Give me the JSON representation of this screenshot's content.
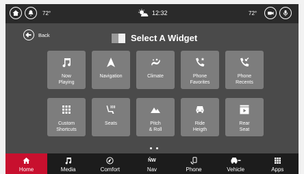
{
  "status": {
    "temp_left": "72°",
    "temp_right": "72°",
    "time": "12:32"
  },
  "header": {
    "back_label": "Back",
    "title": "Select A Widget",
    "accent_color": "#c8102e"
  },
  "widgets": [
    {
      "label": "Now\nPlaying",
      "icon": "music-note-icon"
    },
    {
      "label": "Navigation",
      "icon": "navigation-arrow-icon"
    },
    {
      "label": "Climate",
      "icon": "climate-fan-icon"
    },
    {
      "label": "Phone\nFavorites",
      "icon": "phone-star-icon"
    },
    {
      "label": "Phone\nRecents",
      "icon": "phone-recent-icon"
    },
    {
      "label": "Custom\nShortcuts",
      "icon": "grid-icon"
    },
    {
      "label": "Seats",
      "icon": "seat-heat-icon"
    },
    {
      "label": "Pitch\n& Roll",
      "icon": "mountain-icon"
    },
    {
      "label": "Ride\nHeigth",
      "icon": "vehicle-front-icon"
    },
    {
      "label": "Rear\nSeat",
      "icon": "rear-screen-icon"
    }
  ],
  "pager": {
    "pages": 2
  },
  "nav": [
    {
      "label": "Home",
      "icon": "home-icon",
      "active": true
    },
    {
      "label": "Media",
      "icon": "music-note-icon"
    },
    {
      "label": "Comfort",
      "icon": "comfort-icon"
    },
    {
      "label": "Nav",
      "icon": "compass-nw-icon",
      "glyph": "N̂W"
    },
    {
      "label": "Phone",
      "icon": "phone-icon"
    },
    {
      "label": "Vehicle",
      "icon": "vehicle-icon"
    },
    {
      "label": "Apps",
      "icon": "apps-grid-icon"
    }
  ]
}
